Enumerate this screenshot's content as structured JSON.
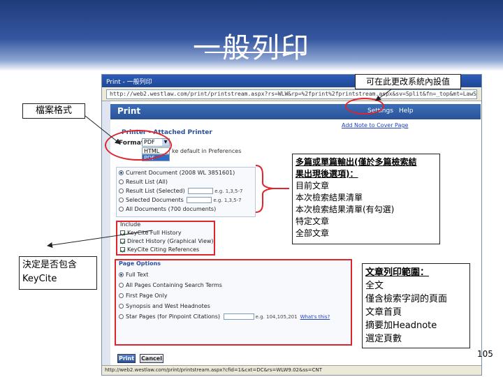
{
  "slide": {
    "title": "一般列印",
    "page_number": "105"
  },
  "window": {
    "title": "Print - 一般列印",
    "address": "http://web2.westlaw.com/print/printstream.aspx?rs=WLW&rp=%2fprint%2fprintstream.aspx&sv=Split&fn=_top&mt=LawSchool",
    "status": "http://web2.westlaw.com/print/printstream.aspx?cfid=1&cxt=DC&rs=WLW9.02&ss=CNT"
  },
  "print_panel": {
    "title": "Print",
    "settings_link": "Settings",
    "help_link": "Help",
    "cover_link": "Add Note to Cover Page",
    "printer_label": "Printer - Attached Printer",
    "format_label": "Format",
    "format_value": "PDF",
    "format_options": [
      "HTML",
      "PDF"
    ],
    "default_text": "ke default in Preferences",
    "documents": [
      {
        "label": "Current Document (2008 WL 3851601)",
        "selected": true,
        "has_input": false,
        "eg": ""
      },
      {
        "label": "Result List (All)",
        "selected": false,
        "has_input": false,
        "eg": ""
      },
      {
        "label": "Result List (Selected)",
        "selected": false,
        "has_input": true,
        "eg": "e.g. 1,3,5-7"
      },
      {
        "label": "Selected Documents",
        "selected": false,
        "has_input": true,
        "eg": "e.g. 1,3,5-7"
      },
      {
        "label": "All Documents (700 documents)",
        "selected": false,
        "has_input": false,
        "eg": ""
      }
    ],
    "include_title": "Include",
    "include_items": [
      {
        "label": "KeyCite Full History",
        "checked": true
      },
      {
        "label": "Direct History (Graphical View)",
        "checked": true
      },
      {
        "label": "KeyCite Citing References",
        "checked": true
      }
    ],
    "page_options_title": "Page Options",
    "page_options": [
      {
        "label": "Full Text",
        "selected": true
      },
      {
        "label": "All Pages Containing Search Terms",
        "selected": false
      },
      {
        "label": "First Page Only",
        "selected": false
      },
      {
        "label": "Synopsis and West Headnotes",
        "selected": false
      },
      {
        "label": "Star Pages (for Pinpoint Citations)",
        "selected": false
      }
    ],
    "star_pages_eg": "e.g. 104,105,201",
    "whats_this": "What's this?",
    "print_button": "Print",
    "cancel_button": "Cancel"
  },
  "callouts": {
    "settings": "可在此更改系統內設值",
    "format": "檔案格式",
    "keycite": [
      "決定是否包含",
      "KeyCite"
    ],
    "output_head": [
      "多篇或單篇輸出(僅於多篇檢索結",
      "果出現後選項)："
    ],
    "output_items": [
      "目前文章",
      "本次檢索結果清單",
      "本次檢索結果清單(有勾選)",
      "特定文章",
      "全部文章"
    ],
    "range_head": "文章列印範圍：",
    "range_items": [
      "全文",
      "僅含檢索字詞的頁面",
      "文章首頁",
      "摘要加Headnote",
      "選定頁數"
    ]
  },
  "colors": {
    "highlight": "#e0242e",
    "header_blue": "#2a5298"
  }
}
